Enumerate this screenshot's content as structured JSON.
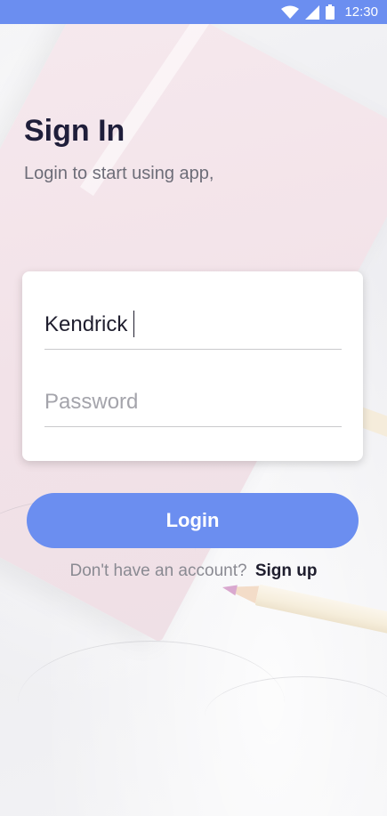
{
  "status_bar": {
    "time": "12:30",
    "icons": [
      "wifi-icon",
      "signal-icon",
      "battery-icon"
    ],
    "background_color": "#6b8ef0"
  },
  "header": {
    "title": "Sign In",
    "subtitle": "Login to start using app,"
  },
  "form": {
    "username": {
      "value": "Kendrick",
      "placeholder": ""
    },
    "password": {
      "value": "",
      "placeholder": "Password"
    }
  },
  "login_button": {
    "label": "Login",
    "color": "#6b8ef0"
  },
  "signup": {
    "prompt": "Don't have an account?",
    "link": "Sign up"
  }
}
